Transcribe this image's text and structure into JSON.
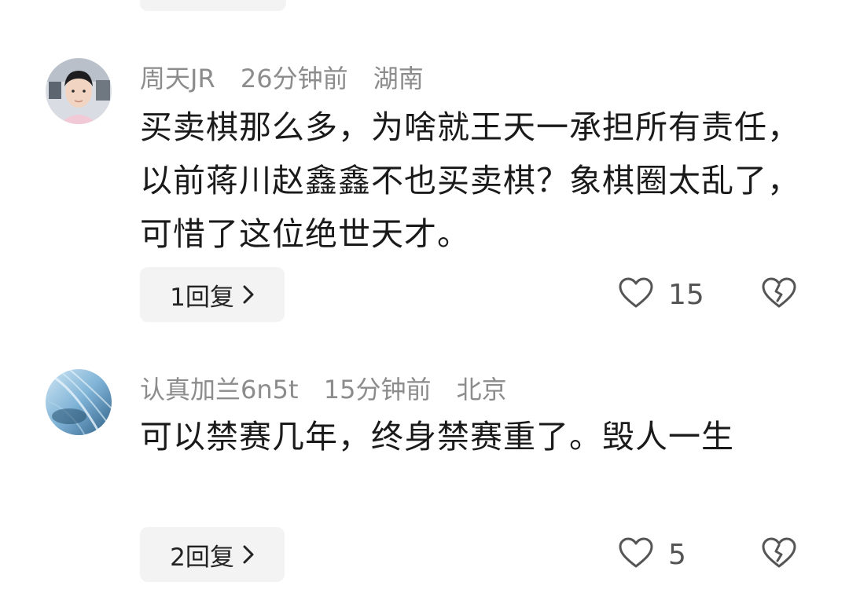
{
  "comments": [
    {
      "username": "周天JR",
      "time": "26分钟前",
      "location": "湖南",
      "text": "买卖棋那么多，为啥就王天一承担所有责任，以前蒋川赵鑫鑫不也买卖棋？象棋圈太乱了，可惜了这位绝世天才。",
      "reply_label": "1回复",
      "likes": "15"
    },
    {
      "username": "认真加兰6n5t",
      "time": "15分钟前",
      "location": "北京",
      "text": "可以禁赛几年，终身禁赛重了。毁人一生",
      "reply_label": "2回复",
      "likes": "5"
    }
  ]
}
